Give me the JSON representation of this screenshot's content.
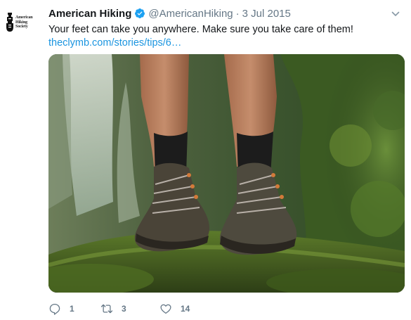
{
  "author": {
    "name": "American Hiking",
    "handle": "@AmericanHiking",
    "separator": "·",
    "date": "3 Jul 2015",
    "avatar_lines": [
      "American",
      "Hiking",
      "Society"
    ]
  },
  "tweet": {
    "text": "Your feet can take you anywhere.  Make sure you take care of them!",
    "link": "theclymb.com/stories/tips/6…"
  },
  "actions": {
    "reply_count": "1",
    "retweet_count": "3",
    "like_count": "14"
  },
  "colors": {
    "link": "#1b95e0",
    "verified": "#1da1f2",
    "muted": "#657786"
  },
  "icons": {
    "verified": "verified-badge-icon",
    "menu": "chevron-down-icon",
    "reply": "reply-icon",
    "retweet": "retweet-icon",
    "like": "heart-icon"
  }
}
